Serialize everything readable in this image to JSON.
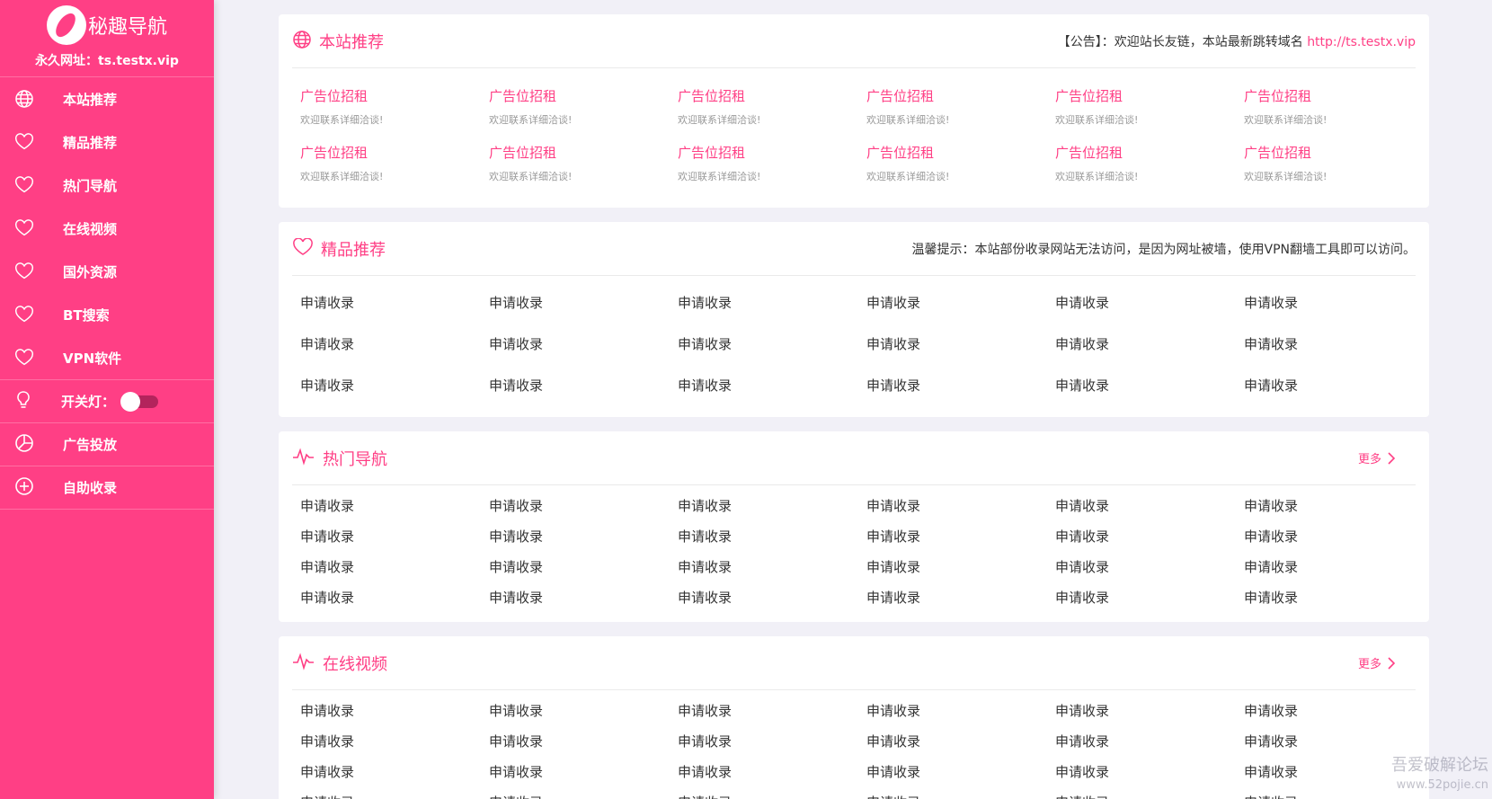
{
  "sidebar": {
    "brand_name": "秘趣导航",
    "permanent_url": "永久网址：ts.testx.vip",
    "nav_items": [
      {
        "label": "本站推荐",
        "icon": "globe-icon"
      },
      {
        "label": "精品推荐",
        "icon": "heart-icon"
      },
      {
        "label": "热门导航",
        "icon": "heart-icon"
      },
      {
        "label": "在线视频",
        "icon": "heart-icon"
      },
      {
        "label": "国外资源",
        "icon": "heart-icon"
      },
      {
        "label": "BT搜索",
        "icon": "heart-icon"
      },
      {
        "label": "VPN软件",
        "icon": "heart-icon"
      }
    ],
    "light_switch_label": "开关灯：",
    "ads_label": "广告投放",
    "submit_label": "自助收录"
  },
  "recommend": {
    "title": "本站推荐",
    "notice_prefix": "【公告】：欢迎站长友链，本站最新跳转域名 ",
    "notice_link": "http://ts.testx.vip",
    "ad_title": "广告位招租",
    "ad_sub": "欢迎联系详细洽谈!",
    "ad_count": 12
  },
  "premium": {
    "title": "精品推荐",
    "tip": "温馨提示：本站部份收录网站无法访问，是因为网址被墙，使用VPN翻墙工具即可以访问。",
    "cells": [
      "申请收录",
      "申请收录",
      "申请收录",
      "申请收录",
      "申请收录",
      "申请收录",
      "申请收录",
      "申请收录",
      "申请收录",
      "申请收录",
      "申请收录",
      "申请收录",
      "申请收录",
      "申请收录",
      "申请收录",
      "申请收录",
      "申请收录",
      "申请收录"
    ]
  },
  "hot": {
    "title": "热门导航",
    "more": "更多",
    "cells": [
      "申请收录",
      "申请收录",
      "申请收录",
      "申请收录",
      "申请收录",
      "申请收录",
      "申请收录",
      "申请收录",
      "申请收录",
      "申请收录",
      "申请收录",
      "申请收录",
      "申请收录",
      "申请收录",
      "申请收录",
      "申请收录",
      "申请收录",
      "申请收录",
      "申请收录",
      "申请收录",
      "申请收录",
      "申请收录",
      "申请收录",
      "申请收录"
    ]
  },
  "video": {
    "title": "在线视频",
    "more": "更多",
    "cells": [
      "申请收录",
      "申请收录",
      "申请收录",
      "申请收录",
      "申请收录",
      "申请收录",
      "申请收录",
      "申请收录",
      "申请收录",
      "申请收录",
      "申请收录",
      "申请收录",
      "申请收录",
      "申请收录",
      "申请收录",
      "申请收录",
      "申请收录",
      "申请收录",
      "申请收录",
      "申请收录",
      "申请收录",
      "申请收录",
      "申请收录",
      "申请收录"
    ]
  },
  "watermark": {
    "line1": "吾爱破解论坛",
    "line2": "www.52pojie.cn"
  },
  "colors": {
    "accent": "#ff3f85",
    "background": "#f1f0f7"
  }
}
